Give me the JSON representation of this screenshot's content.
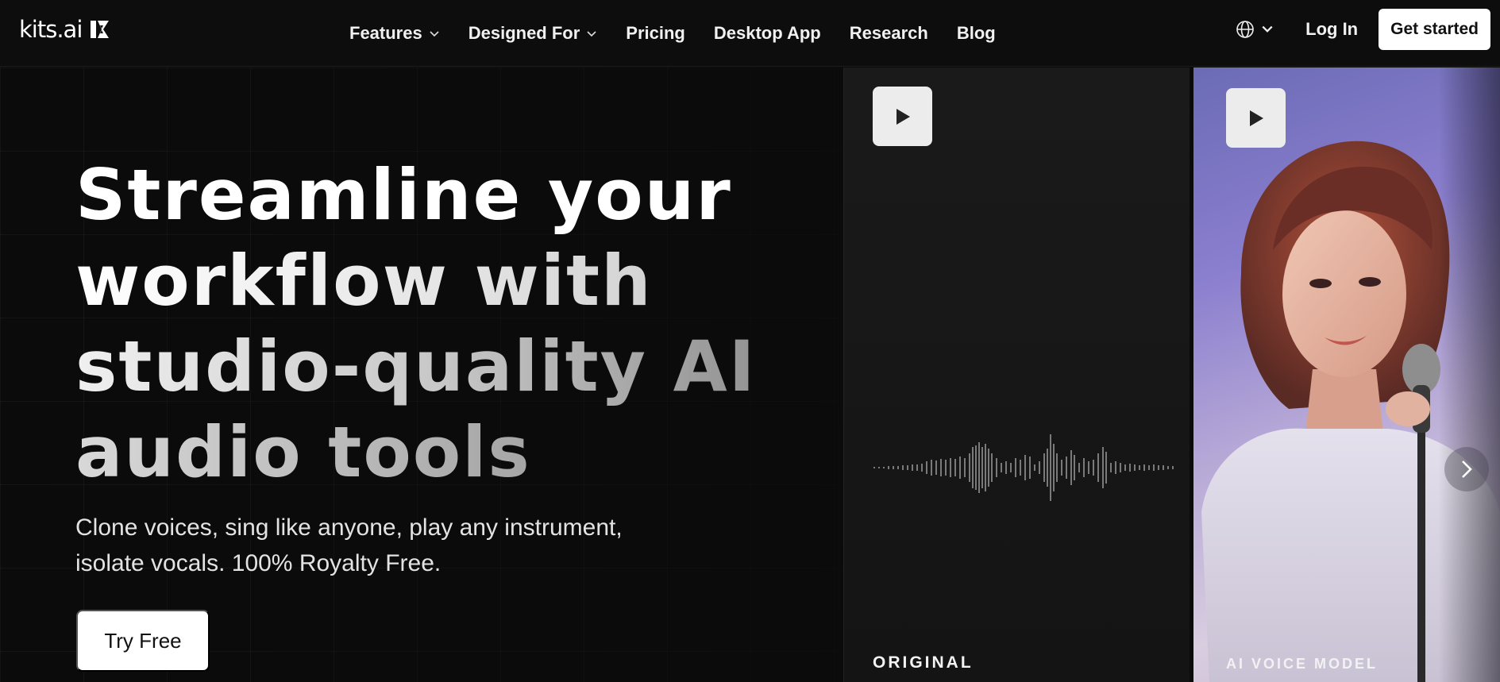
{
  "nav": {
    "logo_text": "kits.ai",
    "links": [
      {
        "label": "Features",
        "dropdown": true
      },
      {
        "label": "Designed For",
        "dropdown": true
      },
      {
        "label": "Pricing",
        "dropdown": false
      },
      {
        "label": "Desktop App",
        "dropdown": false
      },
      {
        "label": "Research",
        "dropdown": false
      },
      {
        "label": "Blog",
        "dropdown": false
      }
    ],
    "language_icon": "globe-icon",
    "login_label": "Log In",
    "cta_label": "Get started"
  },
  "hero": {
    "headline_lines": [
      "Streamline your",
      "workflow with",
      "studio-quality AI",
      "audio tools"
    ],
    "subtitle_lines": [
      "Clone voices, sing like anyone, play any instrument,",
      "isolate vocals. 100% Royalty Free."
    ],
    "cta_label": "Try Free"
  },
  "cards": {
    "original_label": "ORIGINAL",
    "ai_label": "AI VOICE MODEL",
    "play_icon": "play-icon",
    "next_icon": "chevron-right-icon"
  },
  "colors": {
    "background": "#0b0b0b",
    "button_bg": "#ffffff",
    "button_text": "#111111"
  }
}
